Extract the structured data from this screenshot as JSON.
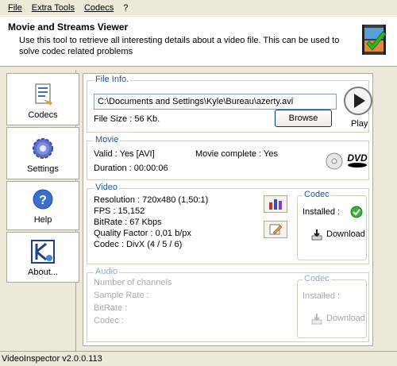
{
  "menu": {
    "file": "File",
    "extra_tools": "Extra Tools",
    "codecs": "Codecs",
    "help": "?"
  },
  "header": {
    "title": "Movie and Streams Viewer",
    "description": "Use this tool to retrieve all interesting details about a video file. This can be used to solve codec related problems",
    "logo_icon": "film-check-icon"
  },
  "nav": {
    "codecs": "Codecs",
    "settings": "Settings",
    "help": "Help",
    "about": "About..."
  },
  "file_info": {
    "title": "File Info.",
    "path": "C:\\Documents and Settings\\Kyle\\Bureau\\azerty.avi",
    "file_size": "File Size : 56 Kb.",
    "browse": "Browse",
    "play": "Play"
  },
  "movie": {
    "title": "Movie",
    "valid": "Valid : Yes [AVI]",
    "complete": "Movie complete : Yes",
    "duration": "Duration : 00:00:06"
  },
  "video": {
    "title": "Video",
    "resolution": "Resolution : 720x480 (1,50:1)",
    "fps": "FPS : 15,152",
    "bitrate": "BitRate : 67 Kbps",
    "quality": "Quality Factor : 0,01 b/px",
    "codec": "Codec : DivX (4 / 5 / 6)",
    "codec_box": {
      "title": "Codec",
      "installed": "Installed :",
      "download": "Download",
      "status_color": "#3DB03D"
    }
  },
  "audio": {
    "title": "Audio",
    "channels": "Number of channels",
    "sample_rate": "Sample Rate :",
    "bitrate": "BitRate :",
    "codec": "Codec :",
    "codec_box": {
      "title": "Codec",
      "installed": "Installed :",
      "download": "Download"
    }
  },
  "status": {
    "version": "VideoInspector v2.0.0.113"
  },
  "colors": {
    "group_title": "#2255A4",
    "window_bg": "#ECE9D8"
  }
}
